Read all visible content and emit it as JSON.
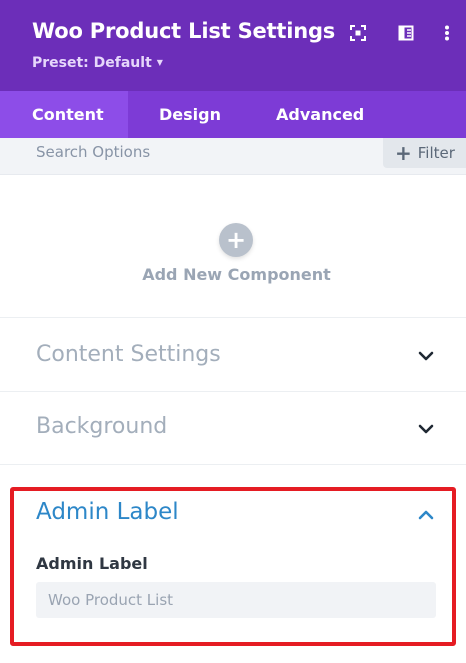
{
  "header": {
    "title": "Woo Product List Settings",
    "preset_label": "Preset: Default",
    "icons": [
      "focus-icon",
      "sidebar-layout-icon",
      "more-vertical-icon"
    ]
  },
  "tabs": [
    {
      "label": "Content",
      "active": true
    },
    {
      "label": "Design",
      "active": false
    },
    {
      "label": "Advanced",
      "active": false
    }
  ],
  "search": {
    "placeholder": "Search Options",
    "value": ""
  },
  "filter": {
    "label": "Filter",
    "icon": "plus-icon"
  },
  "add_component": {
    "label": "Add New Component",
    "icon": "plus-icon"
  },
  "sections": [
    {
      "title": "Content Settings",
      "expanded": false
    },
    {
      "title": "Background",
      "expanded": false
    },
    {
      "title": "Admin Label",
      "expanded": true
    }
  ],
  "admin_label": {
    "field_label": "Admin Label",
    "placeholder": "Woo Product List",
    "value": ""
  },
  "colors": {
    "header_bg": "#6c2eb9",
    "tabs_bg": "#7d3bd6",
    "active_tab_bg": "#8d4de8",
    "highlight_border": "#e51c23",
    "expanded_title": "#2d87c8"
  }
}
